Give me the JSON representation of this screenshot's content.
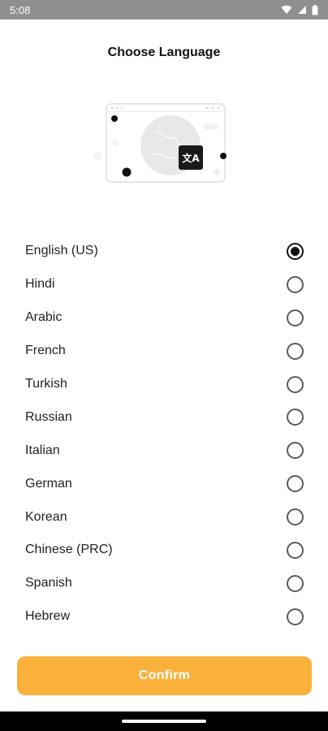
{
  "status_bar": {
    "time": "5:08",
    "icons": [
      "wifi-icon",
      "cell-signal-icon",
      "battery-icon"
    ]
  },
  "header": {
    "title": "Choose Language"
  },
  "illustration": {
    "icon": "translate-icon",
    "glyph": "文A"
  },
  "languages": [
    {
      "label": "English (US)",
      "selected": true
    },
    {
      "label": "Hindi",
      "selected": false
    },
    {
      "label": "Arabic",
      "selected": false
    },
    {
      "label": "French",
      "selected": false
    },
    {
      "label": "Turkish",
      "selected": false
    },
    {
      "label": "Russian",
      "selected": false
    },
    {
      "label": "Italian",
      "selected": false
    },
    {
      "label": "German",
      "selected": false
    },
    {
      "label": "Korean",
      "selected": false
    },
    {
      "label": "Chinese (PRC)",
      "selected": false
    },
    {
      "label": "Spanish",
      "selected": false
    },
    {
      "label": "Hebrew",
      "selected": false
    }
  ],
  "footer": {
    "confirm_label": "Confirm"
  },
  "colors": {
    "accent": "#f9b13c",
    "status_bar": "#8f8f8f"
  }
}
